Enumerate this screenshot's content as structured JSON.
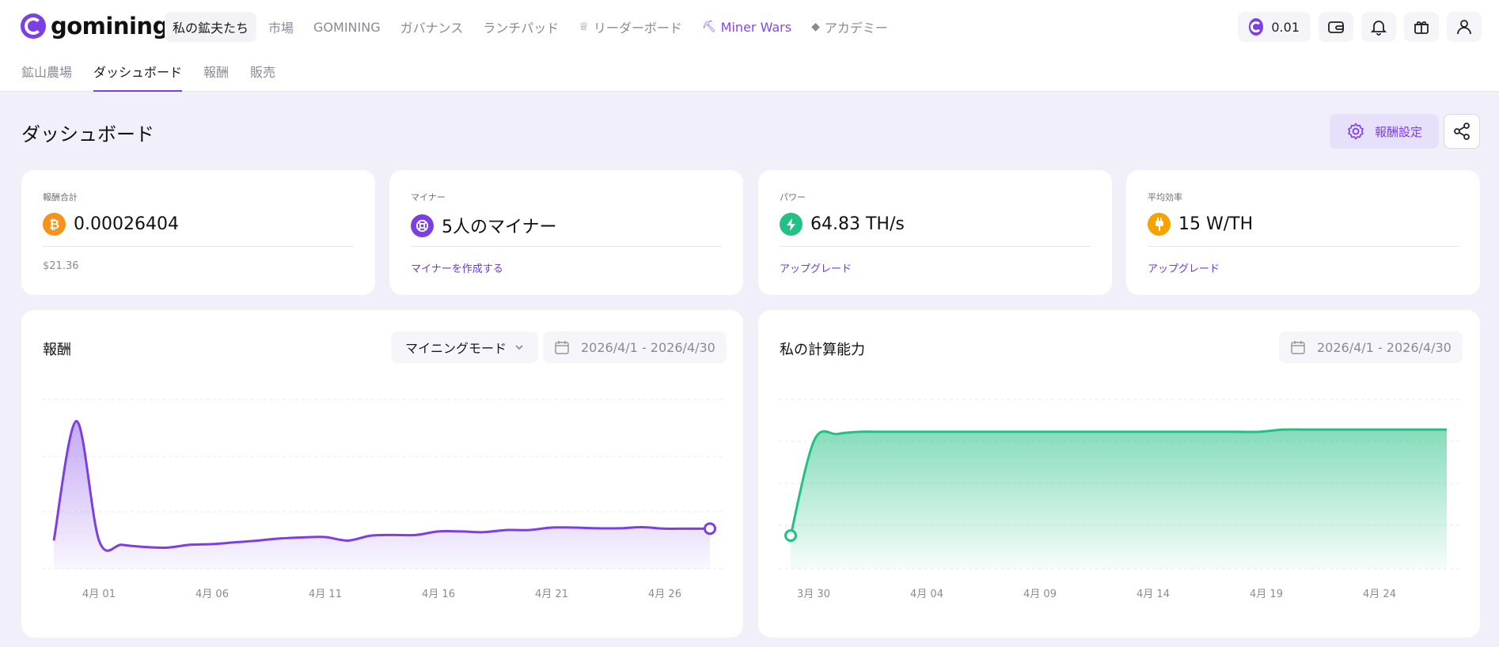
{
  "brand": {
    "name": "gomining"
  },
  "nav": {
    "items": [
      {
        "label": "私の鉱夫たち",
        "icon": "",
        "active": true
      },
      {
        "label": "市場",
        "icon": ""
      },
      {
        "label": "GOMINING",
        "icon": ""
      },
      {
        "label": "ガバナンス",
        "icon": ""
      },
      {
        "label": "ランチパッド",
        "icon": ""
      },
      {
        "label": "リーダーボード",
        "icon": "trophy-icon"
      },
      {
        "label": "Miner Wars",
        "icon": "pickaxe-icon",
        "highlight": true
      },
      {
        "label": "アカデミー",
        "icon": "graduation-cap-icon"
      }
    ]
  },
  "subnav": {
    "items": [
      {
        "label": "鉱山農場"
      },
      {
        "label": "ダッシュボード",
        "active": true
      },
      {
        "label": "報酬"
      },
      {
        "label": "販売"
      }
    ]
  },
  "header_right": {
    "balance": "0.01",
    "icons": [
      "wallet-icon",
      "bell-icon",
      "gift-icon",
      "user-icon"
    ]
  },
  "page": {
    "title": "ダッシュボード",
    "reward_settings_label": "報酬設定"
  },
  "stats": {
    "rewards": {
      "label": "報酬合計",
      "value": "0.00026404",
      "sub": "$21.36",
      "icon": "bitcoin-icon",
      "color": "#f7931a"
    },
    "miners": {
      "label": "マイナー",
      "value": "5人のマイナー",
      "link": "マイナーを作成する",
      "icon": "miner-icon",
      "color": "#7b3fe4"
    },
    "power": {
      "label": "パワー",
      "value": "64.83 TH/s",
      "link": "アップグレード",
      "icon": "lightning-icon",
      "color": "#22c084"
    },
    "efficiency": {
      "label": "平均効率",
      "value": "15 W/TH",
      "link": "アップグレード",
      "icon": "plug-icon",
      "color": "#f5a300"
    }
  },
  "rewards_panel": {
    "title": "報酬",
    "mode_label": "マイニングモード",
    "date_range": "2026/4/1 - 2026/4/30"
  },
  "compute_panel": {
    "title": "私の計算能力",
    "date_range": "2026/4/1 - 2026/4/30"
  },
  "chart_data": [
    {
      "type": "area",
      "title": "報酬",
      "x_ticks": [
        "4月 01",
        "4月 06",
        "4月 11",
        "4月 16",
        "4月 21",
        "4月 26"
      ],
      "x": [
        0,
        1,
        2,
        3,
        4,
        5,
        6,
        7,
        8,
        9,
        10,
        11,
        12,
        13,
        14,
        15,
        16,
        17,
        18,
        19,
        20,
        21,
        22,
        23,
        24,
        25,
        26,
        27,
        28,
        29
      ],
      "values": [
        8,
        42,
        8,
        6.8,
        6.2,
        6,
        6.8,
        7,
        7.5,
        8,
        8.6,
        8.9,
        9,
        8,
        9.4,
        9.6,
        9.6,
        10.6,
        10.6,
        10.4,
        11,
        11,
        11.7,
        11.7,
        11.5,
        11.5,
        11.8,
        11.4,
        11.4,
        11.4
      ],
      "color": "#7b3fe4",
      "grid": true,
      "legend": "none"
    },
    {
      "type": "area",
      "title": "私の計算能力",
      "x_ticks": [
        "3月 30",
        "4月 04",
        "4月 09",
        "4月 14",
        "4月 19",
        "4月 24"
      ],
      "x": [
        0,
        1,
        2,
        3,
        4,
        5,
        6,
        7,
        8,
        9,
        10,
        11,
        12,
        13,
        14,
        15,
        16,
        17,
        18,
        19,
        20,
        21,
        22,
        23,
        24,
        25,
        26,
        27,
        28
      ],
      "values": [
        15,
        58,
        61,
        62,
        62,
        62,
        62,
        62,
        62,
        62,
        62,
        62,
        62,
        62,
        62,
        62,
        62,
        62,
        62,
        62,
        62,
        63,
        63,
        63,
        63,
        63,
        63,
        63,
        63
      ],
      "color": "#22c084",
      "grid": true,
      "legend": "none"
    }
  ]
}
